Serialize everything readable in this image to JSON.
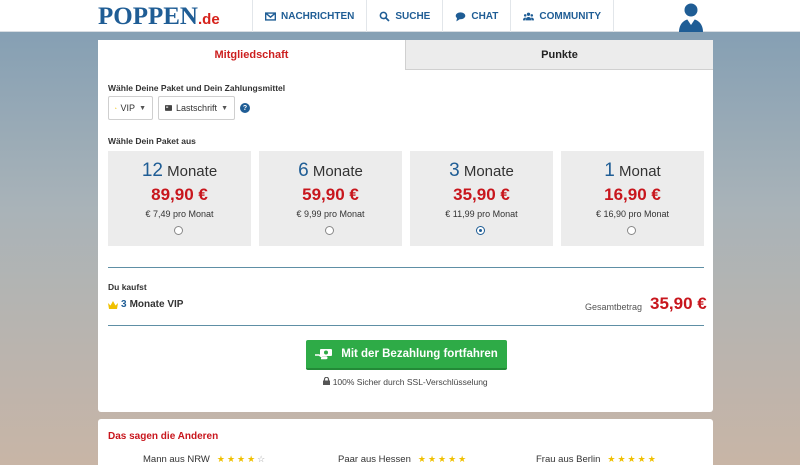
{
  "brand": {
    "logo_main": "POPPEN",
    "logo_tld": ".de"
  },
  "nav": {
    "items": [
      {
        "label": "NACHRICHTEN",
        "icon": "envelope-icon"
      },
      {
        "label": "SUCHE",
        "icon": "search-icon"
      },
      {
        "label": "CHAT",
        "icon": "chat-icon"
      },
      {
        "label": "COMMUNITY",
        "icon": "community-icon"
      }
    ]
  },
  "tabs": {
    "membership": "Mitgliedschaft",
    "points": "Punkte"
  },
  "form": {
    "package_payment_label": "Wähle Deine Paket und Dein Zahlungsmittel",
    "package_select": "VIP",
    "payment_select": "Lastschrift",
    "help": "?",
    "choose_package_label": "Wähle Dein Paket aus"
  },
  "packages": [
    {
      "number": "12",
      "unit": "Monate",
      "price": "89,90 €",
      "per_month": "€ 7,49 pro Monat",
      "selected": false
    },
    {
      "number": "6",
      "unit": "Monate",
      "price": "59,90 €",
      "per_month": "€ 9,99 pro Monat",
      "selected": false
    },
    {
      "number": "3",
      "unit": "Monate",
      "price": "35,90 €",
      "per_month": "€ 11,99 pro Monat",
      "selected": true
    },
    {
      "number": "1",
      "unit": "Monat",
      "price": "16,90 €",
      "per_month": "€ 16,90 pro Monat",
      "selected": false
    }
  ],
  "summary": {
    "label": "Du kaufst",
    "item_number": "3",
    "item_text": "Monate VIP",
    "total_label": "Gesamtbetrag",
    "total_value": "35,90 €"
  },
  "cta": {
    "label": "Mit der Bezahlung fortfahren"
  },
  "secure_note": "100% Sicher durch SSL-Verschlüsselung",
  "reviews": {
    "title": "Das sagen die Anderen",
    "items": [
      {
        "author": "Mann aus NRW",
        "stars": 4
      },
      {
        "author": "Paar aus Hessen",
        "stars": 5
      },
      {
        "author": "Frau aus Berlin",
        "stars": 5
      }
    ]
  },
  "colors": {
    "brand_blue": "#1f5d95",
    "accent_red": "#c8161d",
    "cta_green": "#2eab47",
    "crown_gold": "#f0c000"
  }
}
